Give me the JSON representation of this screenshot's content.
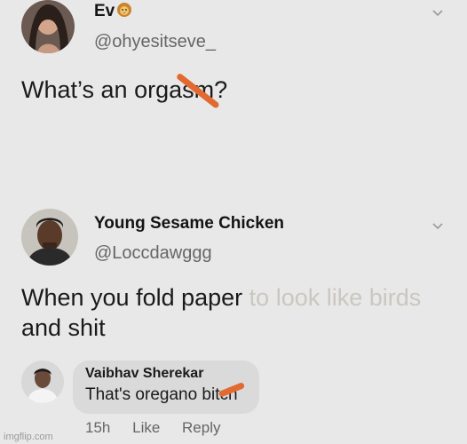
{
  "post1": {
    "name": "Ev",
    "name_emoji": "lion-face",
    "handle": "@ohyesitseve_",
    "text": "What’s an orgasm?"
  },
  "post2": {
    "name": "Young Sesame Chicken",
    "handle": "@Loccdawggg",
    "text_before": "When you fold paper ",
    "text_faded": "to look like birds",
    "text_after": "",
    "text_line2": "and shit"
  },
  "comment": {
    "name": "Vaibhav Sherekar",
    "text": "That's oregano bitch",
    "time": "15h",
    "like_label": "Like",
    "reply_label": "Reply"
  },
  "watermark": "imgflip.com",
  "colors": {
    "background": "#e8e8e8",
    "scribble": "#e2692f",
    "handle_gray": "#666666",
    "bubble": "#dadada"
  }
}
